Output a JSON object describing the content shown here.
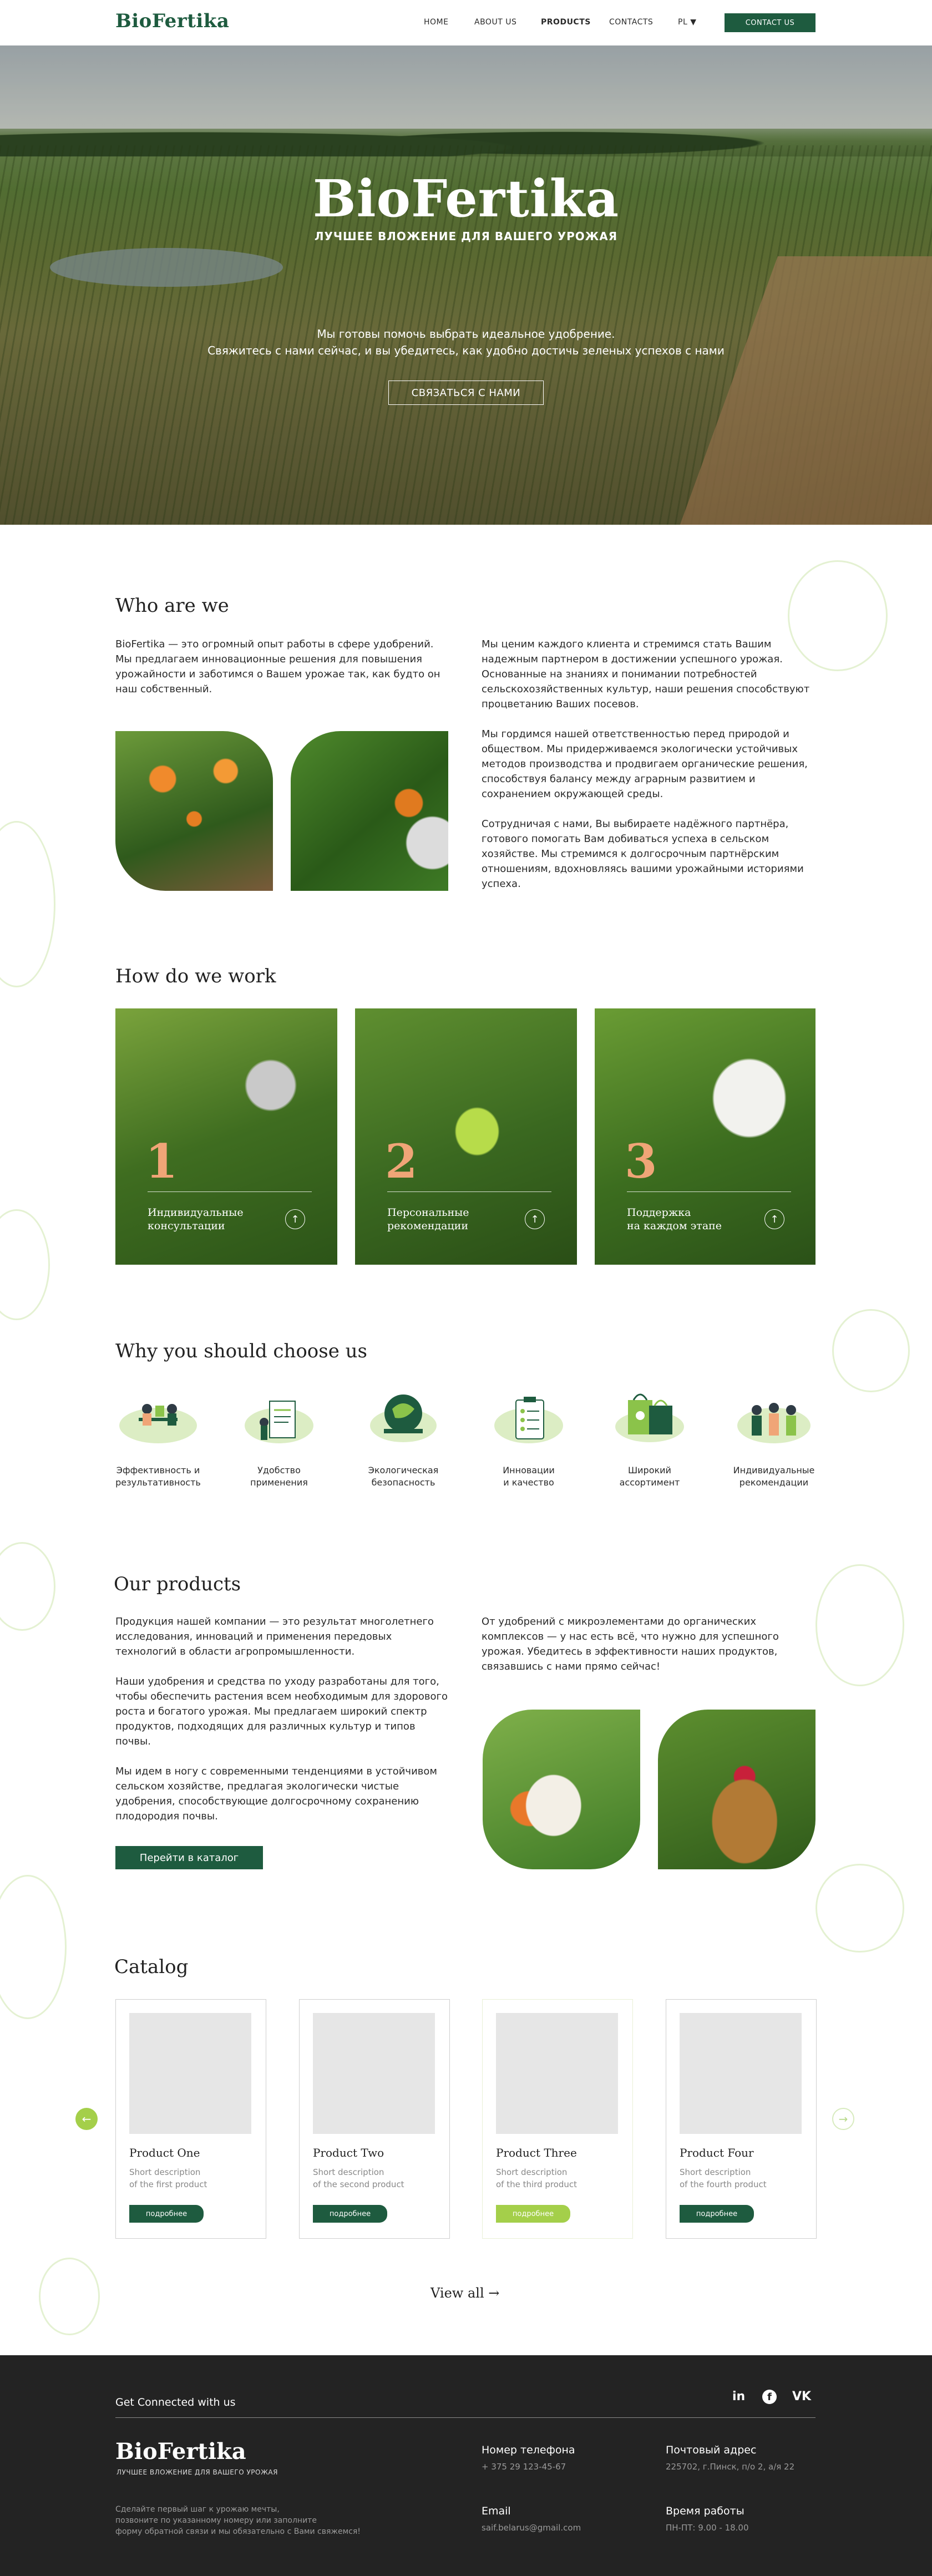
{
  "header": {
    "logo": "BioFertika",
    "nav": [
      "HOME",
      "ABOUT US",
      "PRODUCTS",
      "CONTACTS",
      "PL ▼"
    ],
    "contact_button": "CONTACT US"
  },
  "hero": {
    "logo": "BioFertika",
    "tagline": "ЛУЧШЕЕ ВЛОЖЕНИЕ ДЛЯ ВАШЕГО УРОЖАЯ",
    "line1": "Мы готовы помочь выбрать идеальное удобрение.",
    "line2": "Свяжитесь с нами сейчас, и вы убедитесь, как удобно достичь зеленых успехов с нами",
    "button": "СВЯЗАТЬСЯ С НАМИ"
  },
  "who": {
    "title": "Who are we",
    "left_text": "BioFertika — это огромный опыт работы в сфере удобрений. Мы предлагаем инновационные решения для повышения урожайности и заботимся о Вашем урожае так, как будто он наш собственный.",
    "right_p1": "Мы ценим каждого клиента и стремимся стать Вашим надежным партнером в достижении успешного урожая. Основанные на знаниях и понимании потребностей сельскохозяйственных культур, наши решения способствуют процветанию Ваших посевов.",
    "right_p2": "Мы гордимся нашей ответственностью перед природой и обществом. Мы придерживаемся экологически устойчивых методов производства и продвигаем органические решения, способствуя балансу между аграрным развитием и сохранением окружающей среды.",
    "right_p3": "Сотрудничая с нами, Вы выбираете надёжного партнёра, готового помогать Вам добиваться успеха в сельском хозяйстве. Мы стремимся к долгосрочным партнёрским отношениям, вдохновляясь вашими урожайными историями успеха."
  },
  "how": {
    "title": "How do we work",
    "cards": [
      {
        "num": "1",
        "line1": "Индивидуальные",
        "line2": "консультации"
      },
      {
        "num": "2",
        "line1": "Персональные",
        "line2": "рекомендации"
      },
      {
        "num": "3",
        "line1": "Поддержка",
        "line2": "на каждом этапе"
      }
    ]
  },
  "why": {
    "title": "Why you should choose us",
    "items": [
      {
        "icon": "team-meeting-icon",
        "line1": "Эффективность и",
        "line2": "результативность"
      },
      {
        "icon": "document-icon",
        "line1": "Удобство",
        "line2": "применения"
      },
      {
        "icon": "eco-globe-icon",
        "line1": "Экологическая",
        "line2": "безопасность"
      },
      {
        "icon": "clipboard-icon",
        "line1": "Инновации",
        "line2": "и качество"
      },
      {
        "icon": "shopping-bags-icon",
        "line1": "Широкий",
        "line2": "ассортимент"
      },
      {
        "icon": "people-icon",
        "line1": "Индивидуальные",
        "line2": "рекомендации"
      }
    ]
  },
  "products": {
    "title": "Our products",
    "p1": "Продукция нашей компании — это результат многолетнего исследования, инноваций и применения передовых технологий в области агропромышленности.",
    "p2": "Наши удобрения и средства по уходу разработаны для того, чтобы обеспечить растения всем необходимым для здорового роста и богатого урожая. Мы предлагаем широкий спектр продуктов, подходящих для различных культур и типов почвы.",
    "p3": "Мы идем в ногу с современными тенденциями в устойчивом сельском хозяйстве, предлагая экологически чистые удобрения, способствующие долгосрочному сохранению плодородия почвы.",
    "right": "От удобрений с микроэлементами до органических комплексов — у нас есть всё, что нужно для успешного урожая. Убедитесь в эффективности наших продуктов, связавшись с нами прямо сейчас!",
    "button": "Перейти в каталог"
  },
  "catalog": {
    "title": "Catalog",
    "items": [
      {
        "name": "Product One",
        "desc1": "Short description",
        "desc2": "of the first product",
        "button": "подробнее"
      },
      {
        "name": "Product Two",
        "desc1": "Short description",
        "desc2": "of the second product",
        "button": "подробнее"
      },
      {
        "name": "Product Three",
        "desc1": "Short description",
        "desc2": "of the third product",
        "button": "подробнее"
      },
      {
        "name": "Product Four",
        "desc1": "Short description",
        "desc2": "of the fourth product",
        "button": "подробнее"
      }
    ],
    "view_all": "View all →"
  },
  "footer": {
    "connected": "Get Connected with us",
    "logo": "BioFertika",
    "tagline": "ЛУЧШЕЕ ВЛОЖЕНИЕ ДЛЯ ВАШЕГО УРОЖАЯ",
    "blurb1": "Сделайте первый шаг к урожаю мечты,",
    "blurb2": "позвоните по указанному номеру или заполните",
    "blurb3": "форму обратной связи и мы обязательно с Вами свяжемся!",
    "phone_title": "Номер телефона",
    "phone": "+ 375 29 123-45-67",
    "address_title": "Почтовый адрес",
    "address": "225702, г.Пинск, п/о 2, а/я 22",
    "email_title": "Email",
    "email": "saif.belarus@gmail.com",
    "hours_title": "Время работы",
    "hours": "ПН-ПТ: 9.00 - 18.00",
    "social": [
      "in",
      "f",
      "VK"
    ]
  },
  "colors": {
    "brand": "#1e5b3f",
    "accent": "#8bc34a",
    "number": "#f0a577",
    "footer": "#232323"
  }
}
